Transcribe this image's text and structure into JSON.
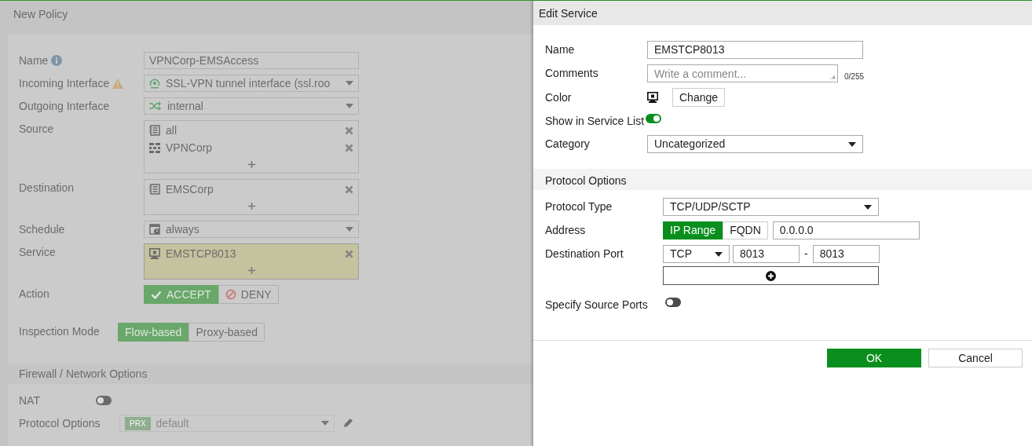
{
  "policy": {
    "title": "New Policy",
    "fields": [
      {
        "kind": "input",
        "label": "Name",
        "info": true,
        "value": "VPNCorp-EMSAccess"
      },
      {
        "kind": "select",
        "label": "Incoming Interface",
        "warning": true,
        "value": "SSL-VPN tunnel interface (ssl.roo"
      },
      {
        "kind": "select",
        "label": "Outgoing Interface",
        "value": "internal"
      },
      {
        "kind": "list",
        "label": "Source",
        "items": [
          {
            "kind": "address",
            "label": "all"
          },
          {
            "kind": "group",
            "label": "VPNCorp"
          }
        ]
      },
      {
        "kind": "list",
        "label": "Destination",
        "items": [
          {
            "kind": "address",
            "label": "EMSCorp"
          }
        ]
      },
      {
        "kind": "select",
        "label": "Schedule",
        "value": "always"
      },
      {
        "kind": "list",
        "label": "Service",
        "highlighted": true,
        "items": [
          {
            "kind": "service",
            "label": "EMSTCP8013"
          }
        ]
      },
      {
        "kind": "segmented",
        "label": "Action",
        "options": [
          {
            "kind": "accept",
            "label": "ACCEPT",
            "selected": true
          },
          {
            "kind": "deny",
            "label": "DENY",
            "selected": false
          }
        ]
      },
      {
        "kind": "segmented",
        "label": "Inspection Mode",
        "options": [
          {
            "label": "Flow-based",
            "selected": true
          },
          {
            "label": "Proxy-based",
            "selected": false
          }
        ]
      }
    ],
    "section": {
      "title": "Firewall / Network Options",
      "fields": [
        {
          "kind": "toggle",
          "label": "NAT",
          "on": false
        },
        {
          "kind": "profile",
          "label": "Protocol Options",
          "badge": "PRX",
          "value": "default",
          "disabled": true
        }
      ]
    }
  },
  "edit_service": {
    "title": "Edit Service",
    "fields": [
      {
        "kind": "input",
        "label": "Name",
        "value": "EMSTCP8013"
      },
      {
        "kind": "textarea",
        "label": "Comments",
        "placeholder": "Write a comment...",
        "counter": "0/255"
      },
      {
        "kind": "color",
        "label": "Color",
        "button": "Change"
      },
      {
        "kind": "toggle",
        "label": "Show in Service List",
        "on": true
      },
      {
        "kind": "select",
        "label": "Category",
        "value": "Uncategorized"
      }
    ],
    "section": {
      "title": "Protocol Options",
      "protocol_type": {
        "label": "Protocol Type",
        "value": "TCP/UDP/SCTP"
      },
      "address": {
        "label": "Address",
        "options": [
          {
            "label": "IP Range",
            "selected": true
          },
          {
            "label": "FQDN",
            "selected": false
          }
        ],
        "value": "0.0.0.0"
      },
      "destination_port": {
        "label": "Destination Port",
        "protocol": "TCP",
        "low": "8013",
        "separator": "-",
        "high": "8013"
      },
      "specify_source_ports": {
        "label": "Specify Source Ports",
        "on": false
      }
    },
    "buttons": [
      {
        "kind": "primary",
        "label": "OK"
      },
      {
        "kind": "secondary",
        "label": "Cancel"
      }
    ]
  }
}
